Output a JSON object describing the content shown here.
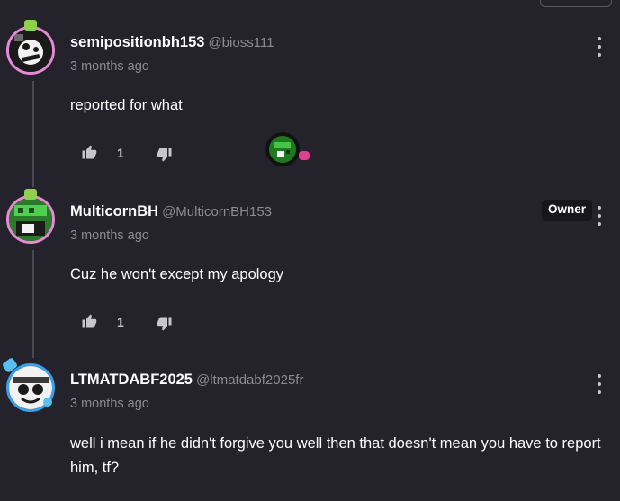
{
  "comments": [
    {
      "username": "semipositionbh153",
      "handle": "@bioss111",
      "time": "3 months ago",
      "text": "reported for what",
      "likes": "1",
      "owner_badge": ""
    },
    {
      "username": "MulticornBH",
      "handle": "@MulticornBH153",
      "time": "3 months ago",
      "text": "Cuz he won't except my apology",
      "likes": "1",
      "owner_badge": "Owner"
    },
    {
      "username": "LTMATDABF2025",
      "handle": "@ltmatdabf2025fr",
      "time": "3 months ago",
      "text": "well i mean if he didn't forgive you well then that doesn't mean you have to report him, tf?",
      "likes": "",
      "owner_badge": ""
    }
  ],
  "icons": {
    "like": "thumbs-up-icon",
    "dislike": "thumbs-down-icon",
    "more": "kebab-menu-icon",
    "reply_indicator": "chat-bubble-icon"
  },
  "colors": {
    "background": "#24222b",
    "avatar_ring": "#e58ad6",
    "muted_text": "#8c8a94",
    "reply_dot": "#e0408f"
  }
}
